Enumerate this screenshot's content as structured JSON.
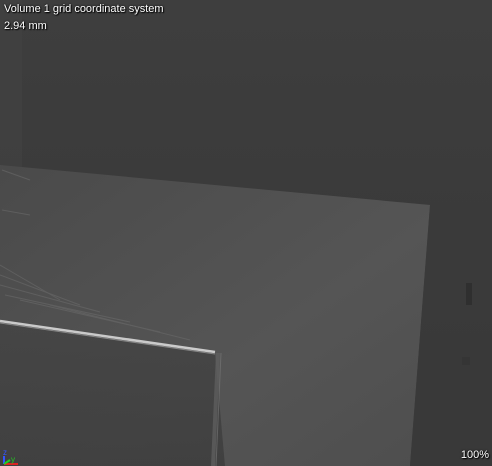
{
  "viewport": {
    "title": "Volume 1 grid coordinate system",
    "slice_position": "2.94 mm",
    "zoom": "100%"
  },
  "axis_triad": {
    "labels": {
      "z": "z",
      "y": "y"
    },
    "colors": {
      "z": "#3355ff",
      "y": "#22cc22",
      "x": "#dd2222"
    }
  },
  "colors": {
    "background": "#3b3b3b",
    "object_face": "#555555",
    "overlay_text": "#ffffff"
  }
}
